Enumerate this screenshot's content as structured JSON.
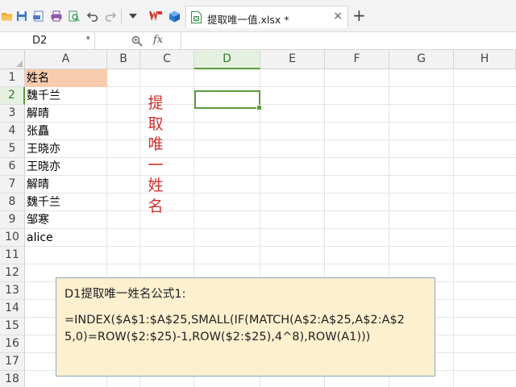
{
  "document": {
    "tab_title": "提取唯一值.xlsx *",
    "tab_close": "×",
    "new_tab": "+"
  },
  "toolbar": {
    "icons": [
      "open-folder-icon",
      "save-icon",
      "export-pdf-icon",
      "print-icon",
      "print-preview-icon",
      "undo-icon",
      "redo-icon",
      "more-dropdown-icon",
      "wps-logo-icon",
      "app-cube-icon"
    ]
  },
  "formula_bar": {
    "name_box": "D2",
    "name_box_arrow": "▾",
    "zoom_glyph": "🔍",
    "fx_label": "fx",
    "formula": ""
  },
  "sheet": {
    "columns": [
      "A",
      "B",
      "C",
      "D",
      "E",
      "F",
      "G",
      "H"
    ],
    "active_column": "D",
    "rows": [
      "1",
      "2",
      "3",
      "4",
      "5",
      "6",
      "7",
      "8",
      "9",
      "10",
      "11",
      "12",
      "13",
      "14",
      "15",
      "16",
      "17",
      "18"
    ],
    "active_row": "2",
    "header_fill": "#f8cbad",
    "column_a": [
      "姓名",
      "魏千兰",
      "解晴",
      "张矗",
      "王晓亦",
      "王晓亦",
      "解晴",
      "魏千兰",
      "邹寒",
      "alice"
    ],
    "vertical_label": [
      "提",
      "取",
      "唯",
      "一",
      "姓",
      "名"
    ],
    "vertical_label_color": "#d0302c",
    "selected_cell": "D2"
  },
  "note": {
    "title": "D1提取唯一姓名公式1:",
    "formula_line1": "=INDEX($A$1:$A$25,SMALL(IF(MATCH(A$2:A$25,A$2:A$2",
    "formula_line2": "5,0)=ROW($2:$25)-1,ROW($2:$25),4^8),ROW(A1)))",
    "background": "#fdf0cf",
    "border": "#8aa7c6"
  },
  "colors": {
    "accent": "#5b9a3a",
    "wps_red": "#d6312a"
  }
}
